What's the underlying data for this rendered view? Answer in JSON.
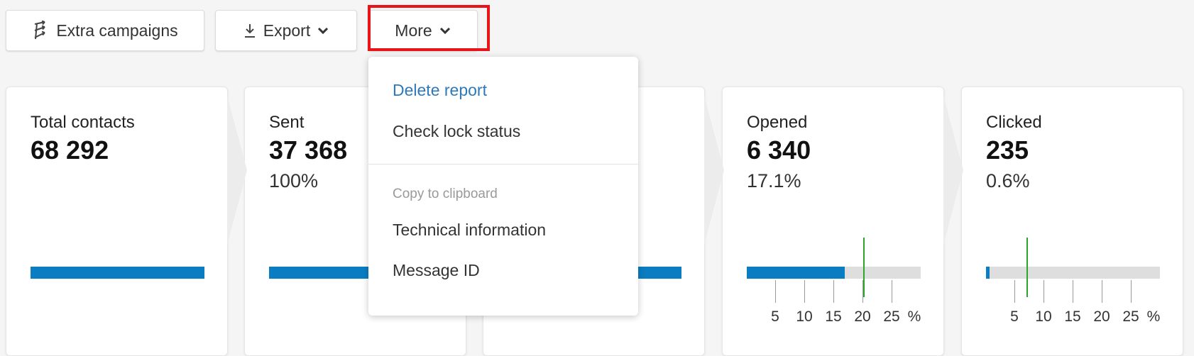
{
  "toolbar": {
    "extra_campaigns_label": "Extra campaigns",
    "export_label": "Export",
    "more_label": "More"
  },
  "cards": [
    {
      "label": "Total contacts",
      "value": "68 292",
      "percent": "",
      "bar_fill": 1.0
    },
    {
      "label": "Sent",
      "value": "37 368",
      "percent": "100%",
      "bar_fill": 1.0
    },
    {
      "label": "",
      "value": "",
      "percent": "",
      "bar_fill": 1.0
    },
    {
      "label": "Opened",
      "value": "6 340",
      "percent": "17.1%",
      "bar_fill": 0.562,
      "scale_ticks": [
        "5",
        "10",
        "15",
        "20",
        "25",
        "%"
      ],
      "benchmark_percent": 20
    },
    {
      "label": "Clicked",
      "value": "235",
      "percent": "0.6%",
      "bar_fill": 0.02,
      "scale_ticks": [
        "5",
        "10",
        "15",
        "20",
        "25",
        "%"
      ],
      "benchmark_percent": 7
    }
  ],
  "more_menu": {
    "delete_report": "Delete report",
    "check_lock_status": "Check lock status",
    "section_header": "Copy to clipboard",
    "technical_information": "Technical information",
    "message_id": "Message ID"
  },
  "colors": {
    "bar": "#0a7dc2",
    "track": "#dedede",
    "benchmark": "#2ba52b",
    "link": "#2f79b8",
    "highlight": "#e8141a"
  }
}
